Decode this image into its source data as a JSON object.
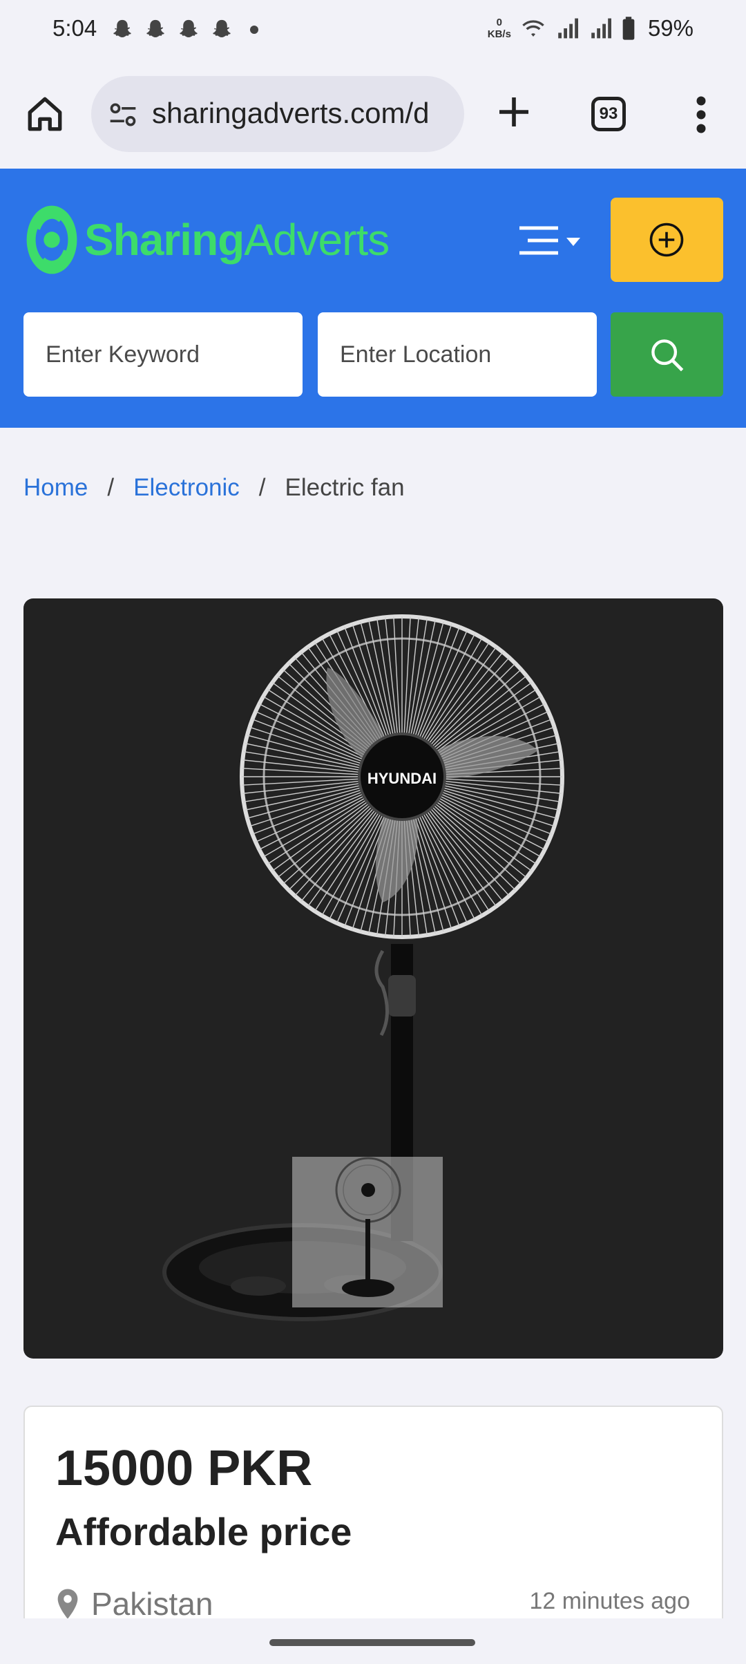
{
  "status_bar": {
    "time": "5:04",
    "net_speed_value": "0",
    "net_speed_unit": "KB/s",
    "battery": "59%"
  },
  "browser": {
    "url": "sharingadverts.com/d",
    "tab_count": "93"
  },
  "header": {
    "logo_bold": "Sharing",
    "logo_light": "Adverts",
    "keyword_placeholder": "Enter Keyword",
    "location_placeholder": "Enter Location",
    "colors": {
      "header_bg": "#2c74e8",
      "post_button": "#fbc02d",
      "search_button": "#37a44a",
      "logo": "#3ddc6a"
    }
  },
  "breadcrumb": {
    "home": "Home",
    "category": "Electronic",
    "current": "Electric fan"
  },
  "product": {
    "image_brand_label": "HYUNDAI",
    "price": "15000 PKR",
    "title": "Affordable price",
    "location": "Pakistan",
    "posted": "12 minutes ago"
  }
}
